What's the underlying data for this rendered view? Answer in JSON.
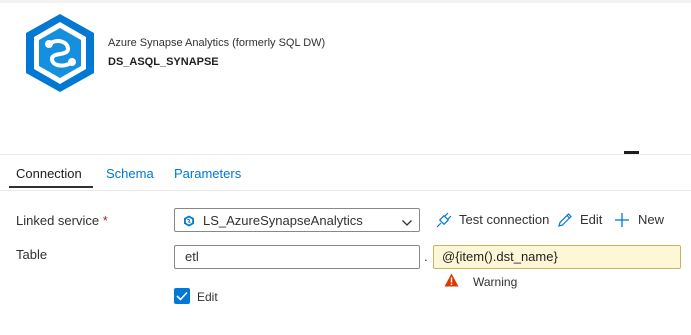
{
  "header": {
    "service_type": "Azure Synapse Analytics (formerly SQL DW)",
    "dataset_name": "DS_ASQL_SYNAPSE",
    "logo_icon": "azure-synapse-icon"
  },
  "tabs": [
    {
      "label": "Connection",
      "selected": true
    },
    {
      "label": "Schema",
      "selected": false
    },
    {
      "label": "Parameters",
      "selected": false
    }
  ],
  "form": {
    "linked_service": {
      "label": "Linked service",
      "required_mark": "*",
      "selected_value": "LS_AzureSynapseAnalytics",
      "icon": "synapse-linked-service-icon"
    },
    "actions": {
      "test_connection": "Test connection",
      "edit": "Edit",
      "new": "New"
    },
    "table": {
      "label": "Table",
      "schema_value": "etl",
      "separator": ".",
      "table_value": "@{item().dst_name}",
      "warning_text": "Warning",
      "edit_checkbox_label": "Edit",
      "edit_checked": true
    }
  },
  "colors": {
    "accent": "#0078d4",
    "warning_fill": "#fdf7d8",
    "warning_icon": "#d83b01"
  }
}
